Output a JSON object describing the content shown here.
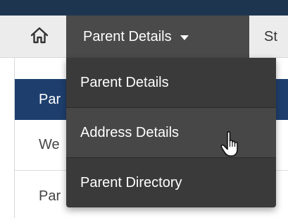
{
  "nav": {
    "home_icon": "home-icon",
    "active_tab_label": "Parent Details",
    "next_tab_label": "St"
  },
  "dropdown": {
    "items": [
      {
        "label": "Parent Details"
      },
      {
        "label": "Address Details"
      },
      {
        "label": "Parent Directory"
      }
    ]
  },
  "content": {
    "panel_title": "Par",
    "rows": [
      {
        "label": "We"
      },
      {
        "label": "Par"
      }
    ]
  },
  "colors": {
    "topbar": "#1e3550",
    "navbar": "#ececec",
    "active_tab": "#4a4a4a",
    "dropdown_bg": "#3a3a3a",
    "dropdown_hover": "#474747",
    "panel_header": "#1e3f6e"
  },
  "cursor": "hand-pointer-icon"
}
